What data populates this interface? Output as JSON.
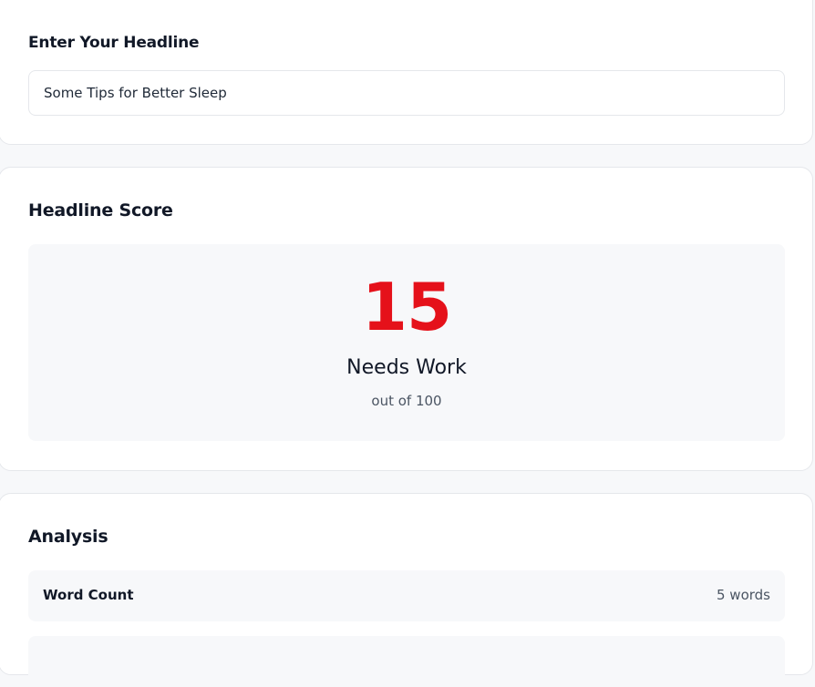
{
  "headline_section": {
    "label": "Enter Your Headline",
    "input_value": "Some Tips for Better Sleep"
  },
  "score_section": {
    "title": "Headline Score",
    "score": "15",
    "rating": "Needs Work",
    "scale": "out of 100",
    "score_color": "#e5111a"
  },
  "analysis_section": {
    "title": "Analysis",
    "rows": [
      {
        "label": "Word Count",
        "value": "5 words"
      }
    ]
  }
}
